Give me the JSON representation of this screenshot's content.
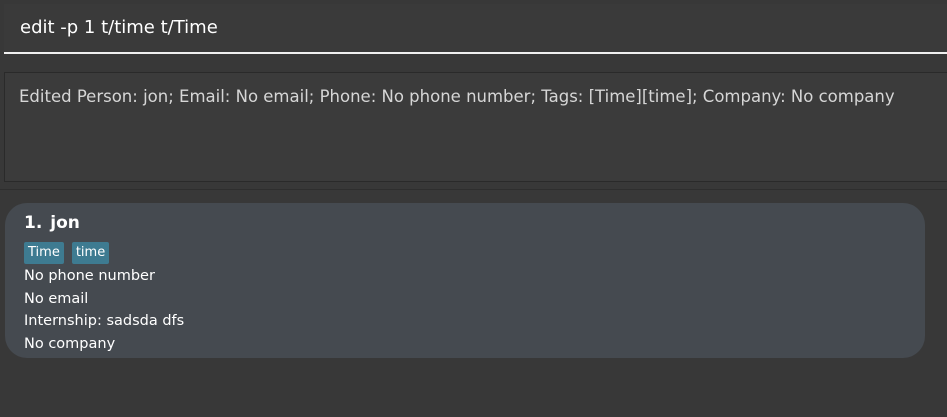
{
  "command": {
    "value": "edit -p 1 t/time t/Time"
  },
  "result": {
    "text": "Edited Person: jon; Email: No email; Phone: No phone number; Tags: [Time][time]; Company: No company"
  },
  "persons": [
    {
      "index": "1.",
      "name": "jon",
      "tags": [
        "Time",
        "time"
      ],
      "phone": "No phone number",
      "email": "No email",
      "internship": "Internship: sadsda dfs",
      "company": "No company"
    }
  ],
  "colors": {
    "background": "#383838",
    "card": "#454a50",
    "tag": "#3e7b91",
    "text": "#ffffff"
  }
}
